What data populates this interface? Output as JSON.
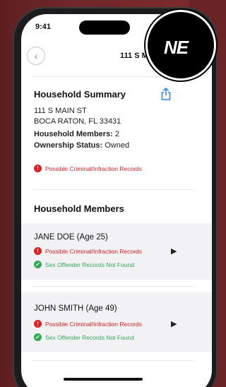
{
  "status": {
    "time": "9:41"
  },
  "nav": {
    "back_icon": "chevron-left-icon",
    "title": "111 S Ma"
  },
  "badge": {
    "text": "NE"
  },
  "summary": {
    "title": "Household Summary",
    "address1": "111 S MAIN ST",
    "address2": "BOCA RATON, FL 33431",
    "members_label": "Household Members:",
    "members_value": "2",
    "ownership_label": "Ownership Status:",
    "ownership_value": "Owned",
    "alert": "Possible Criminal/Infraction Records"
  },
  "members": {
    "title": "Household Members",
    "items": [
      {
        "name": "JANE DOE",
        "age": "(Age 25)",
        "alert": "Possible Criminal/Infraction Records",
        "ok": "Sex Offender Records Not Found"
      },
      {
        "name": "JOHN SMITH",
        "age": "(Age 49)",
        "alert": "Possible Criminal/Infraction Records",
        "ok": "Sex Offender Records Not Found"
      }
    ]
  },
  "colors": {
    "alert": "#e02020",
    "ok": "#34a853",
    "background": "#6b2426"
  }
}
